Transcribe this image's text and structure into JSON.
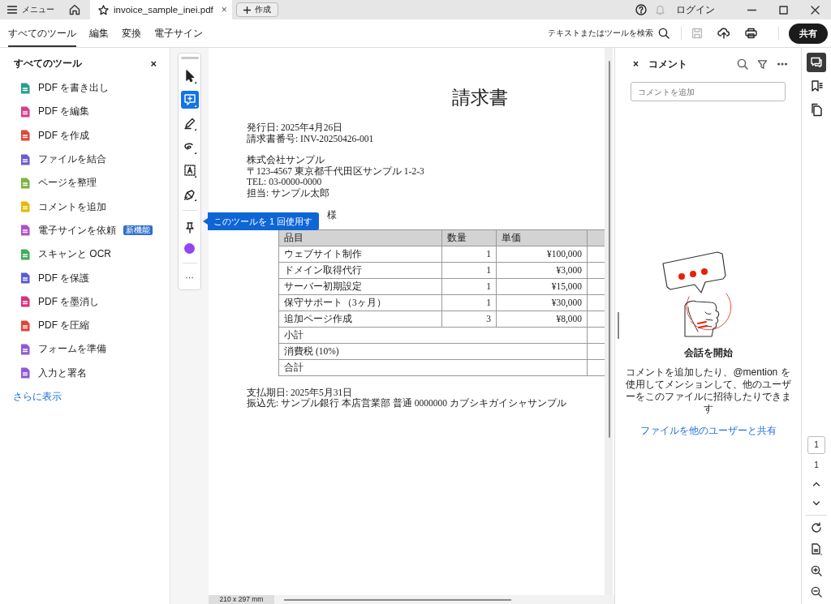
{
  "title_bar": {
    "menu_label": "メニュー",
    "tab": {
      "title": "invoice_sample_inei.pdf",
      "close": "×"
    },
    "create_button": "作成",
    "login": "ログイン"
  },
  "toolbar": {
    "tabs": [
      {
        "label": "すべてのツール",
        "selected": true
      },
      {
        "label": "編集",
        "selected": false
      },
      {
        "label": "変換",
        "selected": false
      },
      {
        "label": "電子サイン",
        "selected": false
      }
    ],
    "search_label": "テキストまたはツールを検索",
    "share_button": "共有"
  },
  "tools_panel": {
    "title": "すべてのツール",
    "close": "×",
    "items": [
      {
        "label": "PDF を書き出し",
        "color": "#2a9d8f"
      },
      {
        "label": "PDF を編集",
        "color": "#d63f8c"
      },
      {
        "label": "PDF を作成",
        "color": "#e0453a"
      },
      {
        "label": "ファイルを結合",
        "color": "#6d5bd0"
      },
      {
        "label": "ページを整理",
        "color": "#7cb342"
      },
      {
        "label": "コメントを追加",
        "color": "#e6b800"
      },
      {
        "label": "電子サインを依頼",
        "color": "#b04fc9",
        "badge": "新機能"
      },
      {
        "label": "スキャンと OCR",
        "color": "#3fae5a"
      },
      {
        "label": "PDF を保護",
        "color": "#5b5bd6"
      },
      {
        "label": "PDF を墨消し",
        "color": "#d6337a"
      },
      {
        "label": "PDF を圧縮",
        "color": "#e0453a"
      },
      {
        "label": "フォームを準備",
        "color": "#8e5ad6"
      },
      {
        "label": "入力と署名",
        "color": "#8e5ad6"
      }
    ],
    "more_link": "さらに表示"
  },
  "quick_tools": [
    {
      "kind": "select",
      "selected": false
    },
    {
      "kind": "comment",
      "selected": true
    },
    {
      "kind": "highlight",
      "selected": false
    },
    {
      "kind": "draw",
      "selected": false
    },
    {
      "kind": "text",
      "selected": false
    },
    {
      "kind": "sign",
      "selected": false
    },
    {
      "kind": "divider"
    },
    {
      "kind": "pin",
      "selected": false
    },
    {
      "kind": "color",
      "color": "#9146f0"
    },
    {
      "kind": "divider"
    },
    {
      "kind": "more",
      "label": "···"
    }
  ],
  "tooltip": "このツールを 1 回使用す",
  "document": {
    "title": "請求書",
    "issue_lines": [
      "発行日: 2025年4月26日",
      "請求書番号: INV-20250426-001"
    ],
    "sender_lines": [
      "株式会社サンプル",
      "〒123-4567 東京都千代田区サンプル 1-2-3",
      "TEL: 03-0000-0000",
      "担当: サンプル太郎"
    ],
    "recipient_visible": "様",
    "table": {
      "columns": [
        "品目",
        "数量",
        "単価"
      ],
      "rows": [
        {
          "item": "ウェブサイト制作",
          "quantity": "1",
          "unit_price": "¥100,000"
        },
        {
          "item": "ドメイン取得代行",
          "quantity": "1",
          "unit_price": "¥3,000"
        },
        {
          "item": "サーバー初期設定",
          "quantity": "1",
          "unit_price": "¥15,000"
        },
        {
          "item": "保守サポート（3ヶ月）",
          "quantity": "1",
          "unit_price": "¥30,000"
        },
        {
          "item": "追加ページ作成",
          "quantity": "3",
          "unit_price": "¥8,000"
        }
      ],
      "summary_rows": [
        "小計",
        "消費税 (10%)",
        "合計"
      ]
    },
    "payment_lines": [
      "支払期日: 2025年5月31日",
      "振込先: サンプル銀行 本店営業部 普通 0000000 カブシキガイシャサンプル"
    ]
  },
  "comments_panel": {
    "close": "×",
    "title": "コメント",
    "placeholder": "コメントを追加",
    "empty_title": "会話を開始",
    "empty_text": "コメントを追加したり、@mention を使用してメンションして、他のユーザーをこのファイルに招待したりできます",
    "share_link": "ファイルを他のユーザーと共有"
  },
  "right_rail": {
    "panels": [
      {
        "kind": "comments",
        "selected": true
      },
      {
        "kind": "bookmarks",
        "selected": false
      },
      {
        "kind": "pages",
        "selected": false
      }
    ],
    "page_input": "1",
    "page_count": "1"
  },
  "status": {
    "page_size": "210 x 297 mm"
  }
}
